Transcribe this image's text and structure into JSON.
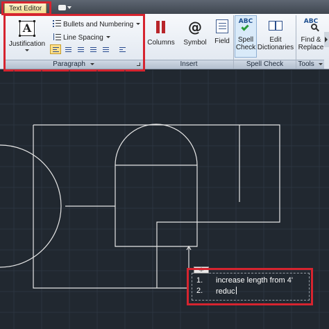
{
  "tabs": {
    "active": "Text Editor"
  },
  "paragraph": {
    "justification_label": "Justification",
    "bullets_label": "Bullets and Numbering",
    "line_spacing_label": "Line Spacing",
    "panel_label": "Paragraph"
  },
  "insert": {
    "columns_label": "Columns",
    "symbol_label": "Symbol",
    "symbol_glyph": "@",
    "field_label": "Field",
    "panel_label": "Insert"
  },
  "spell_check": {
    "spell_label_line1": "Spell",
    "spell_label_line2": "Check",
    "abc_text": "ABC",
    "edit_dict_line1": "Edit",
    "edit_dict_line2": "Dictionaries",
    "panel_label": "Spell Check"
  },
  "tools": {
    "find_line1": "Find &",
    "find_line2": "Replace",
    "abc_text": "ABC",
    "panel_label": "Tools"
  },
  "mtext": {
    "ruler_tag": "◁▷",
    "items": [
      {
        "number": "1.",
        "text": "increase length from 4'"
      },
      {
        "number": "2.",
        "text": "reduc"
      }
    ]
  },
  "colors": {
    "canvas_background": "#212830",
    "highlight_box": "#d6242f",
    "drawing_lines": "#e6e6e6"
  }
}
